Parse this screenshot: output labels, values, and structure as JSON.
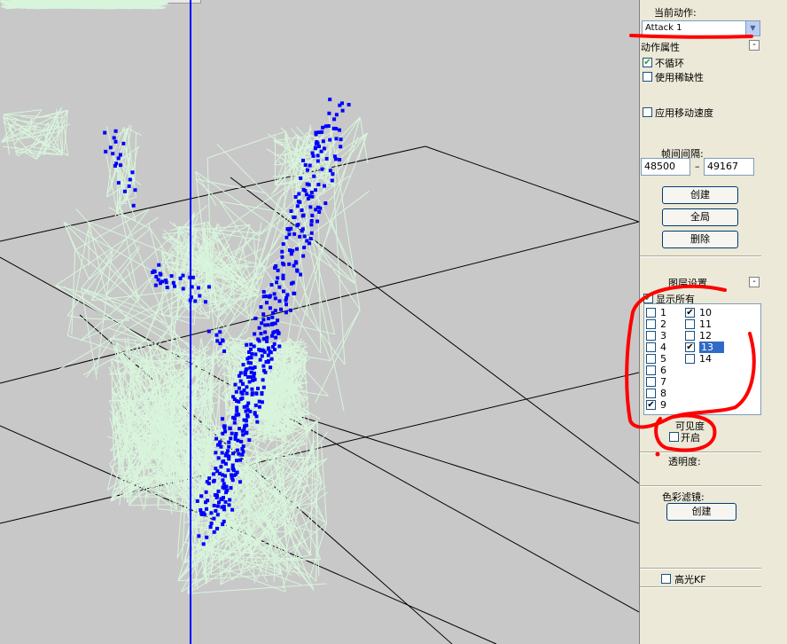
{
  "panel": {
    "current_action_label": "当前动作:",
    "current_action_value": "Attack 1",
    "action_props_label": "动作属性",
    "no_loop_label": "不循环",
    "no_loop_checked": true,
    "use_sparse_label": "使用稀缺性",
    "use_sparse_checked": false,
    "apply_move_speed_label": "应用移动速度",
    "apply_move_speed_checked": false,
    "frame_interval_label": "帧间间隔:",
    "frame_start": "48500",
    "frame_dash": "–",
    "frame_end": "49167",
    "create_button": "创建",
    "global_button": "全局",
    "delete_button": "删除",
    "layer_settings_label": "图层设置",
    "show_all_label": "显示所有",
    "show_all_checked": true,
    "layers": [
      {
        "label": "1",
        "checked": false,
        "selected": false
      },
      {
        "label": "2",
        "checked": false,
        "selected": false
      },
      {
        "label": "3",
        "checked": false,
        "selected": false
      },
      {
        "label": "4",
        "checked": false,
        "selected": false
      },
      {
        "label": "5",
        "checked": false,
        "selected": false
      },
      {
        "label": "6",
        "checked": false,
        "selected": false
      },
      {
        "label": "7",
        "checked": false,
        "selected": false
      },
      {
        "label": "8",
        "checked": false,
        "selected": false
      },
      {
        "label": "9",
        "checked": true,
        "selected": false
      },
      {
        "label": "10",
        "checked": true,
        "selected": false
      },
      {
        "label": "11",
        "checked": false,
        "selected": false
      },
      {
        "label": "12",
        "checked": false,
        "selected": false
      },
      {
        "label": "13",
        "checked": true,
        "selected": true
      },
      {
        "label": "14",
        "checked": false,
        "selected": false
      }
    ],
    "visibility_label": "可见度",
    "enable_label": "开启",
    "enable_checked": false,
    "transparency_label": "透明度:",
    "color_filter_label": "色彩滤镜:",
    "color_filter_create_button": "创建",
    "highlight_kf_label": "高光KF",
    "highlight_kf_checked": false,
    "collapse_glyph": "-",
    "check_glyph": "✔",
    "dropdown_glyph": "▼"
  },
  "icons": {
    "dropdown": "chevron-down-icon",
    "collapse": "minus-icon",
    "check": "checkmark-icon"
  },
  "colors": {
    "viewport_bg": "#c8c8c8",
    "panel_bg": "#ece9d8",
    "axis": "#0000ff",
    "wireframe": "#d8f5dc",
    "points": "#0000ff",
    "annotation": "#ff0000",
    "selection": "#316ac5"
  }
}
